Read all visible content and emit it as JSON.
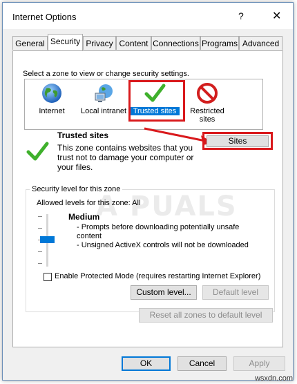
{
  "window": {
    "title": "Internet Options",
    "help_glyph": "?",
    "close_glyph": "✕"
  },
  "tabs": [
    {
      "label": "General"
    },
    {
      "label": "Security"
    },
    {
      "label": "Privacy"
    },
    {
      "label": "Content"
    },
    {
      "label": "Connections"
    },
    {
      "label": "Programs"
    },
    {
      "label": "Advanced"
    }
  ],
  "security": {
    "zone_prompt": "Select a zone to view or change security settings.",
    "zones": [
      {
        "label": "Internet",
        "icon": "globe-icon"
      },
      {
        "label": "Local intranet",
        "icon": "intranet-icon"
      },
      {
        "label": "Trusted sites",
        "icon": "checkmark-icon",
        "selected": true
      },
      {
        "label": "Restricted sites",
        "icon": "no-entry-icon"
      }
    ],
    "zone_title": "Trusted sites",
    "zone_description": "This zone contains websites that you trust not to damage your computer or your files.",
    "sites_button": "Sites",
    "level_group_label": "Security level for this zone",
    "allowed_levels": "Allowed levels for this zone: All",
    "level_name": "Medium",
    "level_bullets": [
      "- Prompts before downloading potentially unsafe content",
      "- Unsigned ActiveX controls will not be downloaded"
    ],
    "protected_mode_label": "Enable Protected Mode (requires restarting Internet Explorer)",
    "protected_mode_checked": false,
    "custom_level_button": "Custom level...",
    "default_level_button": "Default level",
    "reset_all_button": "Reset all zones to default level",
    "slider_level": 0.5
  },
  "footer": {
    "ok": "OK",
    "cancel": "Cancel",
    "apply": "Apply"
  },
  "watermark": {
    "text": "A PUALS",
    "source": "wsxdn.com"
  },
  "colors": {
    "highlight_red": "#d9191c",
    "selection_blue": "#0078d7",
    "check_green": "#3fb02c"
  }
}
